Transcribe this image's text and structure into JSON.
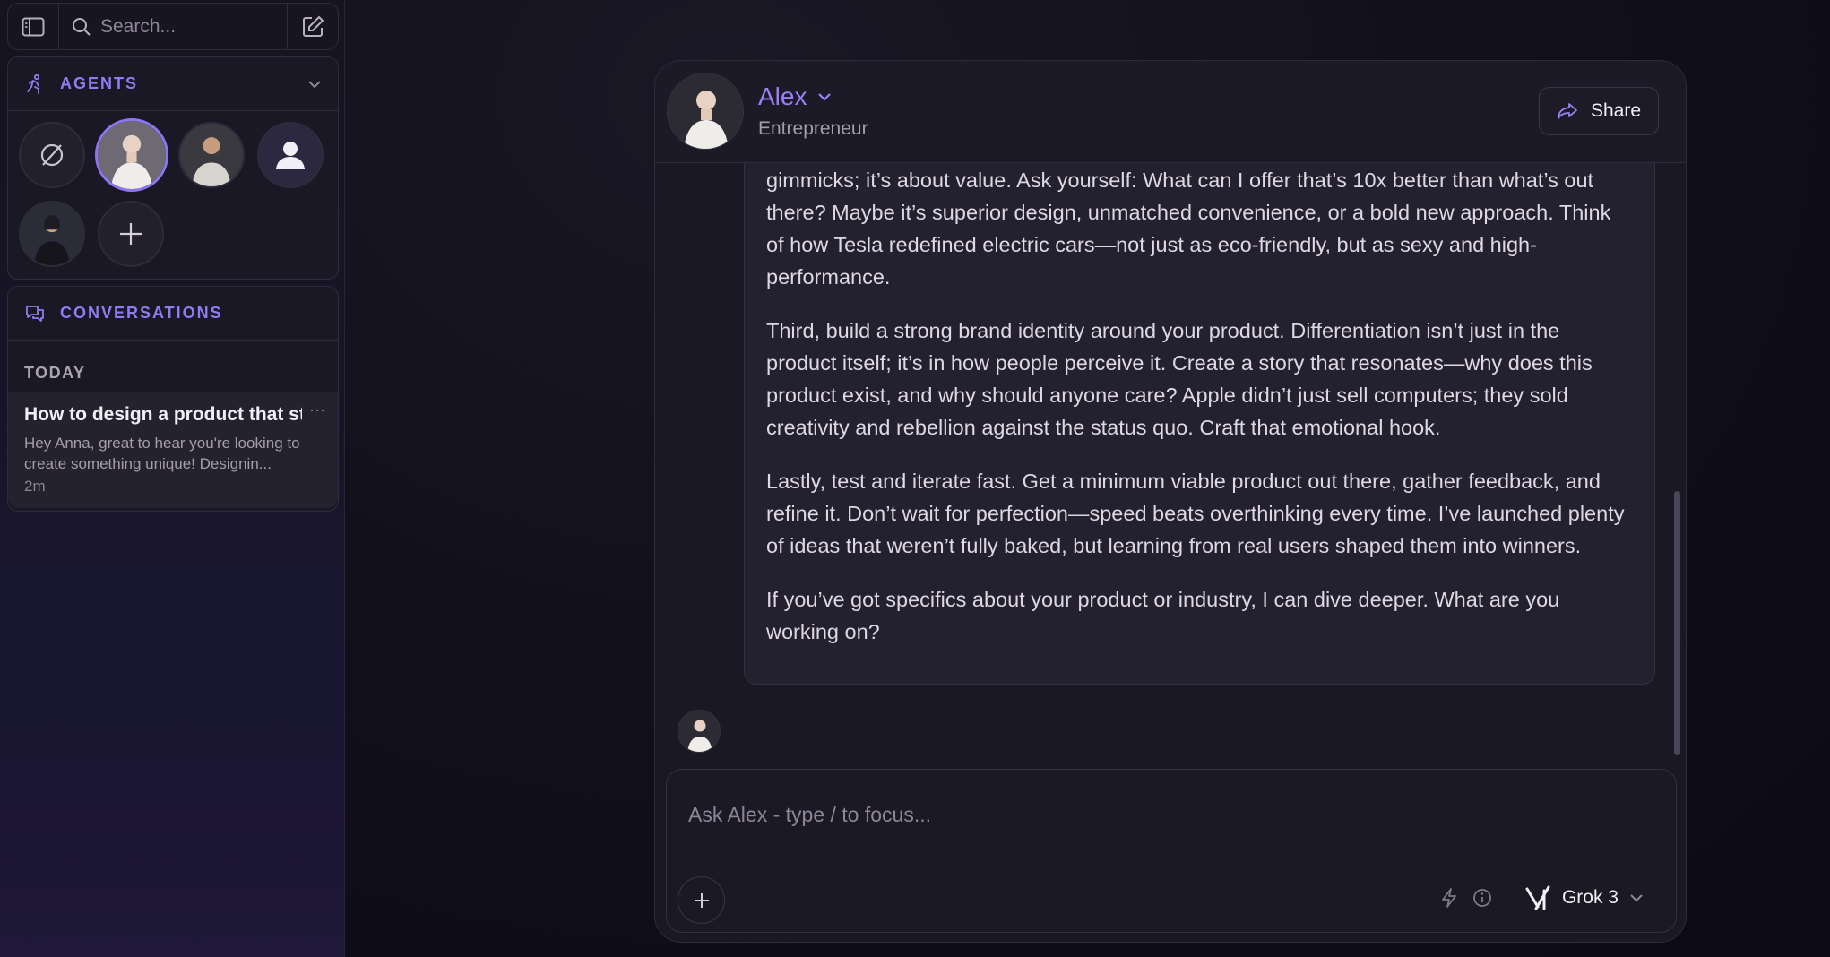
{
  "sidebar": {
    "search_placeholder": "Search...",
    "agents_label": "AGENTS",
    "agents": [
      {
        "name": "none"
      },
      {
        "name": "Alex",
        "selected": true
      },
      {
        "name": "agent-3"
      },
      {
        "name": "default-user"
      },
      {
        "name": "agent-5"
      },
      {
        "name": "add"
      }
    ],
    "conversations_label": "CONVERSATIONS",
    "today_label": "TODAY",
    "conversation": {
      "title": "How to design a product that st...",
      "snippet": "Hey Anna, great to hear you're looking to create something unique! Designin...",
      "time": "2m"
    }
  },
  "chat": {
    "agent_name": "Alex",
    "agent_role": "Entrepreneur",
    "share_label": "Share",
    "paragraphs": [
      "gimmicks; it’s about value. Ask yourself: What can I offer that’s 10x better than what’s out there? Maybe it’s superior design, unmatched convenience, or a bold new approach. Think of how Tesla redefined electric cars—not just as eco-friendly, but as sexy and high-performance.",
      "Third, build a strong brand identity around your product. Differentiation isn’t just in the product itself; it’s in how people perceive it. Create a story that resonates—why does this product exist, and why should anyone care? Apple didn’t just sell computers; they sold creativity and rebellion against the status quo. Craft that emotional hook.",
      "Lastly, test and iterate fast. Get a minimum viable product out there, gather feedback, and refine it. Don’t wait for perfection—speed beats overthinking every time. I’ve launched plenty of ideas that weren’t fully baked, but learning from real users shaped them into winners.",
      "If you’ve got specifics about your product or industry, I can dive deeper. What are you working on?"
    ],
    "input_placeholder": "Ask Alex - type / to focus...",
    "model_label": "Grok 3"
  },
  "colors": {
    "accent": "#8f7cf2",
    "background": "#12101b"
  }
}
